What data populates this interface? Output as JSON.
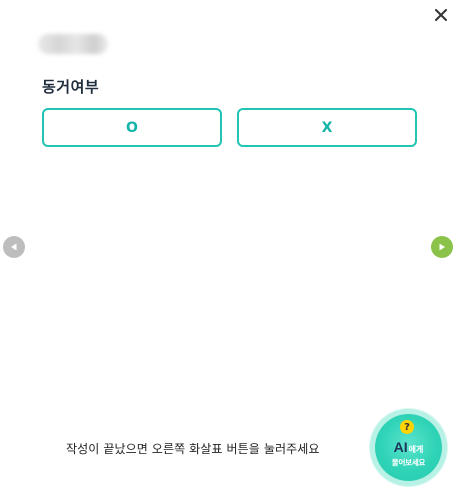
{
  "dialog": {
    "close_icon": "close-icon",
    "blurred_label": "",
    "question": "동거여부"
  },
  "answers": [
    {
      "label": "O"
    },
    {
      "label": "X"
    }
  ],
  "navigation": {
    "prev_icon": "triangle-left-icon",
    "next_icon": "triangle-right-icon",
    "prev_color": "#bdbdbd",
    "next_color": "#8bc34a"
  },
  "footer": {
    "instruction": "작성이 끝났으면 오른쪽 화살표 버튼을 눌러주세요"
  },
  "ai_button": {
    "badge": "?",
    "title_big": "AI",
    "title_small": "에게",
    "subtitle": "물어보세요",
    "color": "#2fd3b6"
  },
  "accent_color": "#22c4b4"
}
